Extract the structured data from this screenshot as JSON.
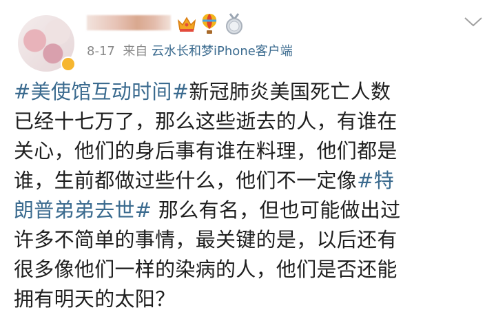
{
  "post": {
    "date": "8-17",
    "from_label": "来自",
    "source": "云水长和梦iPhone客户端",
    "lines": [
      [
        {
          "t": "#美使馆互动时间#",
          "tag": true
        },
        {
          "t": "新冠肺炎美国死亡人数",
          "tag": false
        }
      ],
      [
        {
          "t": "已经十七万了，那么这些逝去的人，有谁在",
          "tag": false
        }
      ],
      [
        {
          "t": "关心，他们的身后事有谁在料理，他们都是",
          "tag": false
        }
      ],
      [
        {
          "t": "谁，生前都做过些什么，他们不一定像",
          "tag": false
        },
        {
          "t": "#特",
          "tag": true
        }
      ],
      [
        {
          "t": "朗普弟弟去世#",
          "tag": true
        },
        {
          "t": " 那么有名，但也可能做出过",
          "tag": false
        }
      ],
      [
        {
          "t": "许多不简单的事情，最关键的是，以后还有",
          "tag": false
        }
      ],
      [
        {
          "t": "很多像他们一样的染病的人，他们是否还能",
          "tag": false
        }
      ],
      [
        {
          "t": "拥有明天的太阳？",
          "tag": false
        }
      ]
    ]
  },
  "icons": [
    "crown-icon",
    "balloon-icon",
    "medal-icon",
    "chevron-down-icon"
  ],
  "colors": {
    "link": "#3b6b8f",
    "meta": "#8a8a8a",
    "text": "#1f1f1f"
  }
}
